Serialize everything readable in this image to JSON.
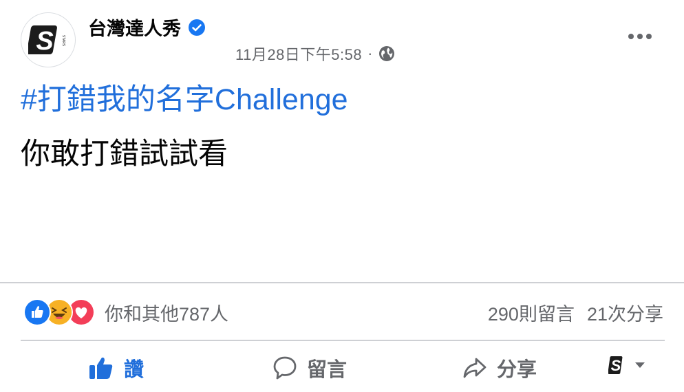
{
  "post": {
    "page_name": "台灣達人秀",
    "verified_icon": "verified-badge-icon",
    "timestamp": "11月28日下午5:58",
    "separator": "·",
    "audience_icon": "globe-icon",
    "avatar_letter": "S",
    "hashtag": "#打錯我的名字Challenge",
    "text": "你敢打錯試試看"
  },
  "engagement": {
    "reactions": [
      "like-icon",
      "haha-icon",
      "love-icon"
    ],
    "reaction_text": "你和其他787人",
    "comments": "290則留言",
    "shares": "21次分享"
  },
  "actions": {
    "like_label": "讚",
    "comment_label": "留言",
    "share_label": "分享"
  },
  "colors": {
    "brand_blue": "#216fdb",
    "secondary_text": "#65676b",
    "love_red": "#f33e58",
    "haha_yellow": "#f7b125"
  }
}
